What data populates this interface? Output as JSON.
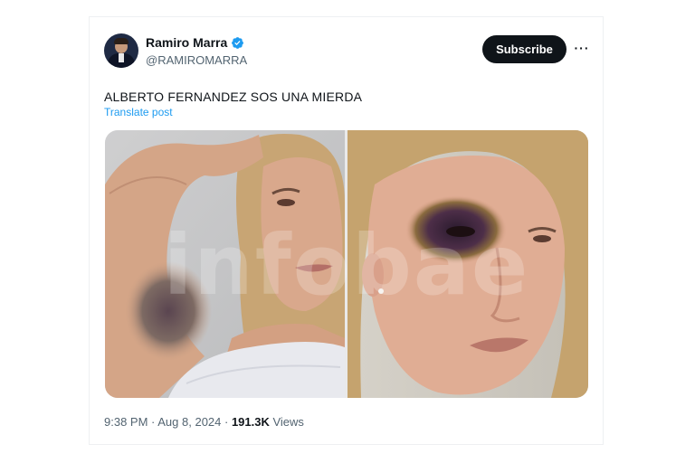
{
  "post": {
    "author": {
      "display_name": "Ramiro Marra",
      "handle": "@RAMIROMARRA",
      "verified": true
    },
    "subscribe_label": "Subscribe",
    "more_label": "···",
    "text": "ALBERTO FERNANDEZ SOS UNA MIERDA",
    "translate_label": "Translate post",
    "media": {
      "watermark": "infobae"
    },
    "meta": {
      "time": "9:38 PM",
      "separator": " · ",
      "date": "Aug 8, 2024",
      "views_count": "191.3K",
      "views_label": " Views"
    }
  },
  "colors": {
    "text_primary": "#0f1419",
    "text_secondary": "#536471",
    "link": "#1d9bf0",
    "verified_badge": "#1d9bf0",
    "button_bg": "#0f1419"
  },
  "icons": [
    "verified-badge-icon",
    "more-options-icon"
  ]
}
